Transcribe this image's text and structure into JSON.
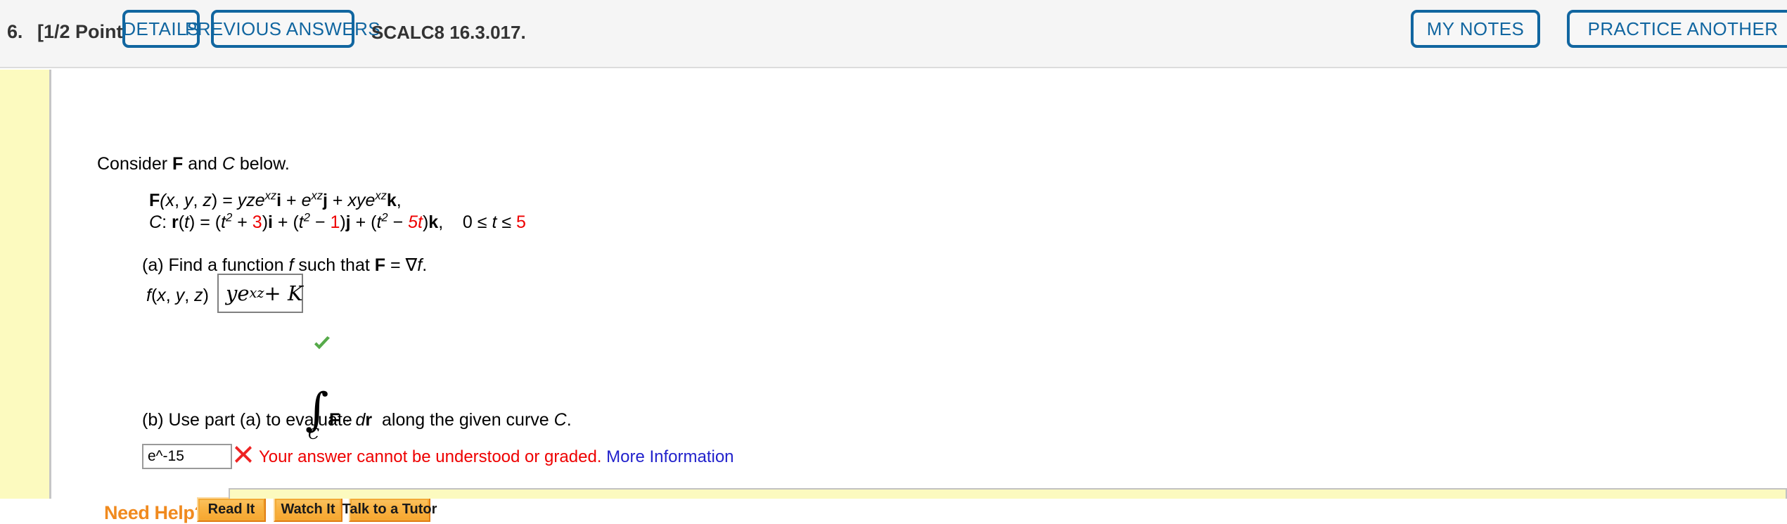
{
  "header": {
    "problem_number": "6.",
    "points_label": "[1/2 Points]",
    "details_label": "DETAILS",
    "previous_answers_label": "PREVIOUS ANSWERS",
    "module_code": "SCALC8 16.3.017.",
    "my_notes_label": "MY NOTES",
    "practice_another_label": "PRACTICE ANOTHER",
    "accent_color": "#1166a0",
    "background_color": "#f5f5f5"
  },
  "question": {
    "prompt": "Consider F and C below.",
    "prompt_parts": {
      "before": "Consider ",
      "bold_F": "F",
      "middle": " and ",
      "italic_C": "C",
      "after": " below."
    },
    "field_definition": {
      "lhs": "F(x, y, z)",
      "rhs": "yze^{xz}i + e^{xz}j + xye^{xz}k,"
    },
    "curve_definition": {
      "label": "C:",
      "rhs": "r(t) = (t^2 + 3)i + (t^2 − 1)j + (t^2 − 5t)k,",
      "domain": "0 ≤ t ≤ 5",
      "const_1": "3",
      "const_2": "1",
      "const_3": "5t",
      "domain_upper": "5",
      "highlight_color": "#ee0000"
    },
    "part_a": {
      "text": "(a) Find a function f such that F = ∇f.",
      "answer_label": "f(x, y, z)  =",
      "answer_value": "ye^{xz} + K",
      "answer_base": "ye",
      "answer_exponent": "xz",
      "answer_tail": " + K",
      "status": "correct",
      "status_icon": "green-check-icon",
      "status_color": "#56aa4a"
    },
    "part_b": {
      "text_before_integral": "(b) Use part (a) to evaluate",
      "integral_glyph": "∫",
      "integral_subscript": "C",
      "text_after_integral": "F · dr  along the given curve C.",
      "answer_value": "e^-15",
      "answer_placeholder": "",
      "status": "incorrect",
      "status_icon": "red-x-icon",
      "status_color": "#ee2222",
      "error_message": "Your answer cannot be understood or graded.",
      "more_info_label": "More Information",
      "more_info_color": "#2222cc"
    }
  },
  "help": {
    "label": "Need Help?",
    "label_color": "#f08a1e",
    "buttons": [
      {
        "label": "Read It",
        "name": "read-it"
      },
      {
        "label": "Watch It",
        "name": "watch-it"
      },
      {
        "label": "Talk to a Tutor",
        "name": "talk-to-a-tutor"
      }
    ]
  },
  "rail": {
    "color": "#fcfabf"
  }
}
